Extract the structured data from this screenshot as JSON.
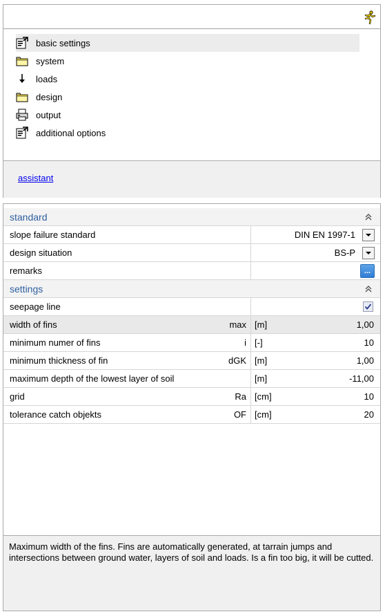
{
  "nav": {
    "items": [
      {
        "label": "basic settings",
        "icon": "properties-icon"
      },
      {
        "label": "system",
        "icon": "folder-icon"
      },
      {
        "label": "loads",
        "icon": "down-arrow-icon"
      },
      {
        "label": "design",
        "icon": "folder-icon"
      },
      {
        "label": "output",
        "icon": "printer-icon"
      },
      {
        "label": "additional options",
        "icon": "properties-icon"
      }
    ],
    "selected": "basic settings"
  },
  "assistant_link": "assistant",
  "grid": {
    "standard_section": "standard",
    "slope_failure_standard": {
      "label": "slope failure standard",
      "value": "DIN EN 1997-1"
    },
    "design_situation": {
      "label": "design situation",
      "value": "BS-P"
    },
    "remarks": {
      "label": "remarks",
      "button": "..."
    },
    "settings_section": "settings",
    "seepage_line": {
      "label": "seepage line",
      "checked": true
    },
    "rows": [
      {
        "label": "width of fins",
        "symbol": "max",
        "unit": "[m]",
        "value": "1,00"
      },
      {
        "label": "minimum numer of fins",
        "symbol": "i",
        "unit": "[-]",
        "value": "10"
      },
      {
        "label": "minimum thickness of fin",
        "symbol": "dGK",
        "unit": "[m]",
        "value": "1,00"
      },
      {
        "label": "maximum depth of the lowest layer of soil",
        "symbol": "",
        "unit": "[m]",
        "value": "-11,00"
      },
      {
        "label": "grid",
        "symbol": "Ra",
        "unit": "[cm]",
        "value": "10"
      },
      {
        "label": "tolerance catch objekts",
        "symbol": "OF",
        "unit": "[cm]",
        "value": "20"
      }
    ]
  },
  "description": "Maximum width of the fins. Fins are automatically generated, at tarrain jumps and intersections between ground water, layers of soil and loads. Is a fin too big, it will be cutted.",
  "colors": {
    "section_title": "#2f5f9f",
    "link": "#0000ee",
    "accent_button": "#2f7dd6"
  }
}
